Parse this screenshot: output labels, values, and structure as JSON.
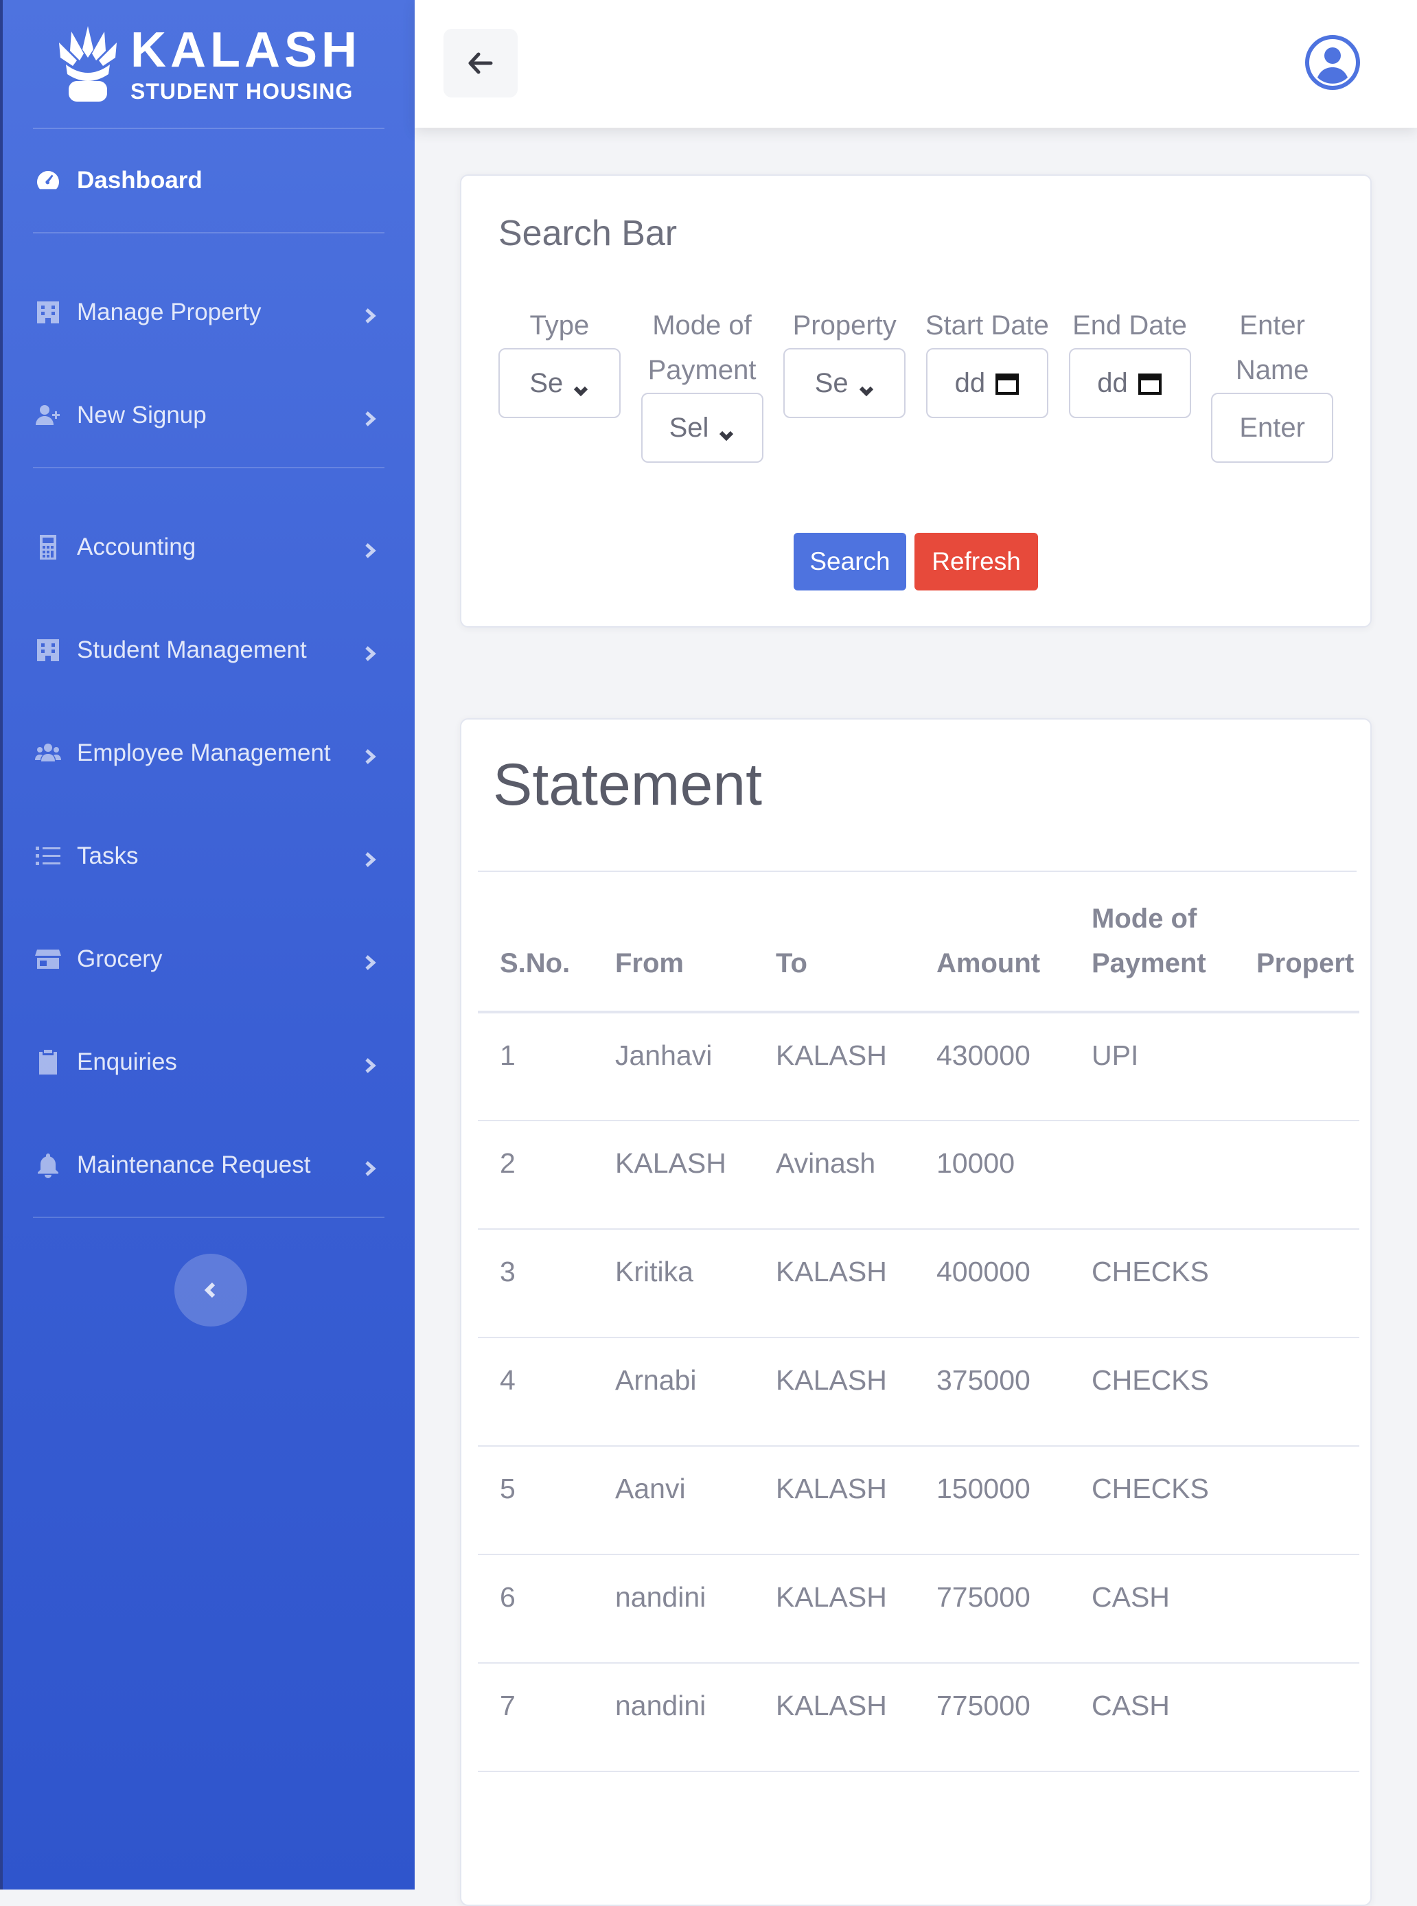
{
  "brand": {
    "title": "KALASH",
    "subtitle": "STUDENT HOUSING",
    "logo_icon": "lotus-logo-icon"
  },
  "sidebar": {
    "items": [
      {
        "label": "Dashboard",
        "icon": "gauge-icon"
      },
      {
        "label": "Manage Property",
        "icon": "building-icon"
      },
      {
        "label": "New Signup",
        "icon": "user-plus-icon"
      },
      {
        "label": "Accounting",
        "icon": "calculator-icon"
      },
      {
        "label": "Student Management",
        "icon": "building-icon"
      },
      {
        "label": "Employee Management",
        "icon": "users-icon"
      },
      {
        "label": "Tasks",
        "icon": "list-icon"
      },
      {
        "label": "Grocery",
        "icon": "store-icon"
      },
      {
        "label": "Enquiries",
        "icon": "clipboard-icon"
      },
      {
        "label": "Maintenance Request",
        "icon": "bell-icon"
      }
    ]
  },
  "search": {
    "title": "Search Bar",
    "filters": [
      {
        "label": "Type",
        "value": "Se"
      },
      {
        "label": "Mode of Payment",
        "value": "Sel"
      },
      {
        "label": "Property",
        "value": "Se"
      },
      {
        "label": "Start Date",
        "value": "dd"
      },
      {
        "label": "End Date",
        "value": "dd"
      },
      {
        "label": "Enter Name",
        "placeholder": "Enter"
      }
    ],
    "search_label": "Search",
    "refresh_label": "Refresh"
  },
  "statement": {
    "title": "Statement",
    "columns": [
      "S.No.",
      "From",
      "To",
      "Amount",
      "Mode of Payment",
      "Propert"
    ],
    "rows": [
      [
        "1",
        "Janhavi",
        "KALASH",
        "430000",
        "UPI",
        ""
      ],
      [
        "2",
        "KALASH",
        "Avinash",
        "10000",
        "",
        ""
      ],
      [
        "3",
        "Kritika",
        "KALASH",
        "400000",
        "CHECKS",
        ""
      ],
      [
        "4",
        "Arnabi",
        "KALASH",
        "375000",
        "CHECKS",
        ""
      ],
      [
        "5",
        "Aanvi",
        "KALASH",
        "150000",
        "CHECKS",
        ""
      ],
      [
        "6",
        "nandini",
        "KALASH",
        "775000",
        "CASH",
        ""
      ],
      [
        "7",
        "nandini",
        "KALASH",
        "775000",
        "CASH",
        ""
      ]
    ]
  },
  "colors": {
    "primary": "#4e73df",
    "danger": "#e74a3b",
    "sidebar_dark": "#2f55cc"
  }
}
